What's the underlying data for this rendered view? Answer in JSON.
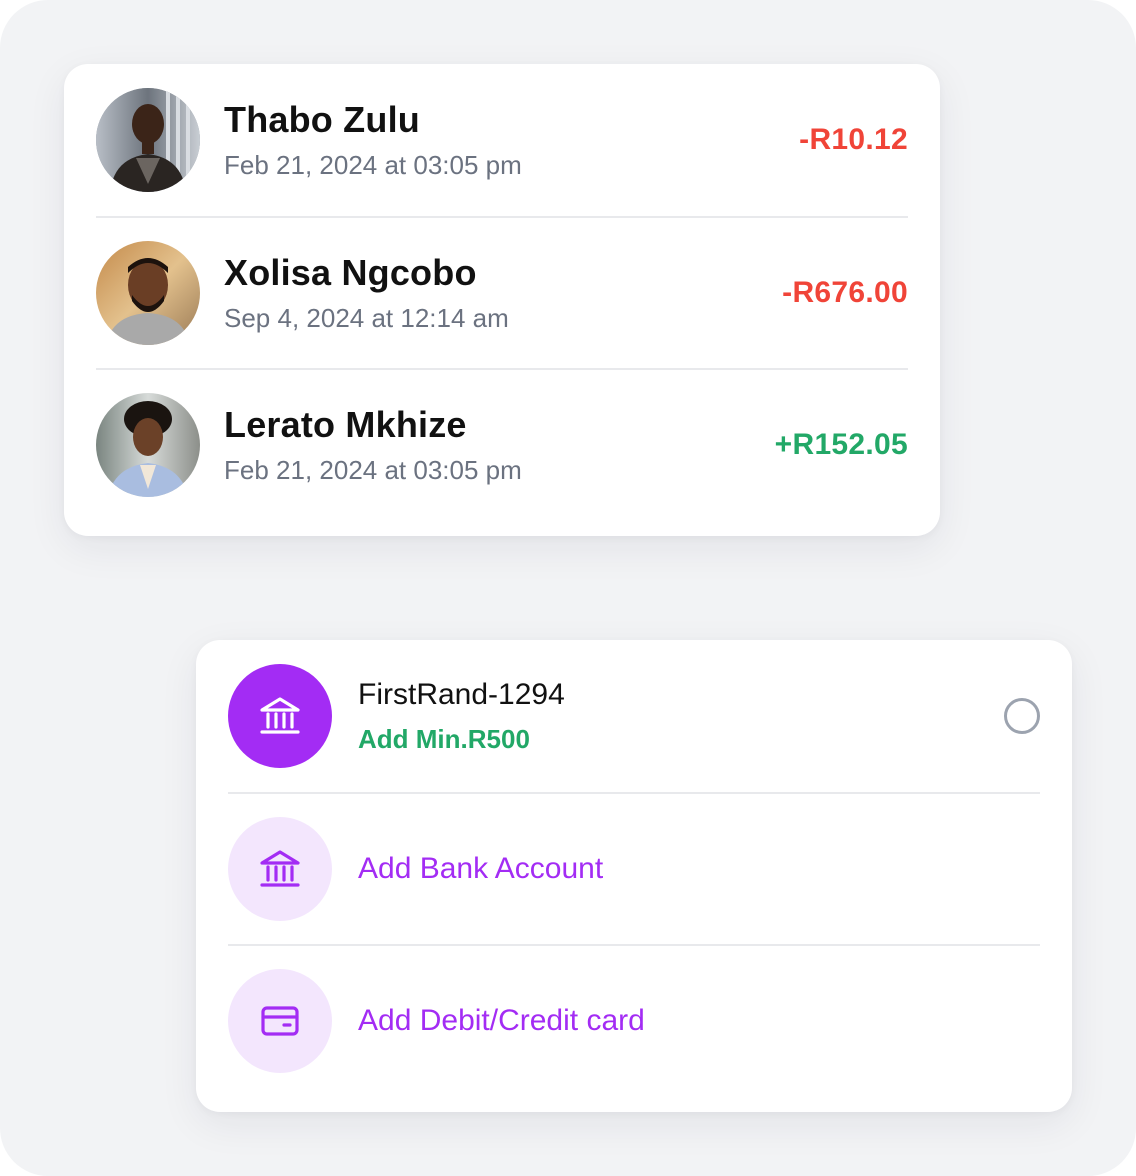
{
  "colors": {
    "negative": "#f04438",
    "positive": "#22a867",
    "accent": "#a32cf4",
    "accent_soft": "#f3e6fd",
    "divider": "#e8e9ec"
  },
  "transactions": [
    {
      "name": "Thabo Zulu",
      "date": "Feb 21, 2024 at 03:05 pm",
      "amount": "-R10.12",
      "direction": "debit",
      "avatar": "avatar-photo-man-jacket"
    },
    {
      "name": "Xolisa Ngcobo",
      "date": "Sep 4, 2024 at 12:14 am",
      "amount": "-R676.00",
      "direction": "debit",
      "avatar": "avatar-photo-man-beard"
    },
    {
      "name": "Lerato Mkhize",
      "date": "Feb 21, 2024 at 03:05 pm",
      "amount": "+R152.05",
      "direction": "credit",
      "avatar": "avatar-photo-woman-blazer"
    }
  ],
  "payment_methods": {
    "selected_account": {
      "title": "FirstRand-1294",
      "subtitle": "Add Min.R500",
      "icon": "bank-icon",
      "selected": false
    },
    "actions": [
      {
        "label": "Add Bank Account",
        "icon": "bank-icon"
      },
      {
        "label": "Add Debit/Credit card",
        "icon": "card-icon"
      }
    ]
  }
}
